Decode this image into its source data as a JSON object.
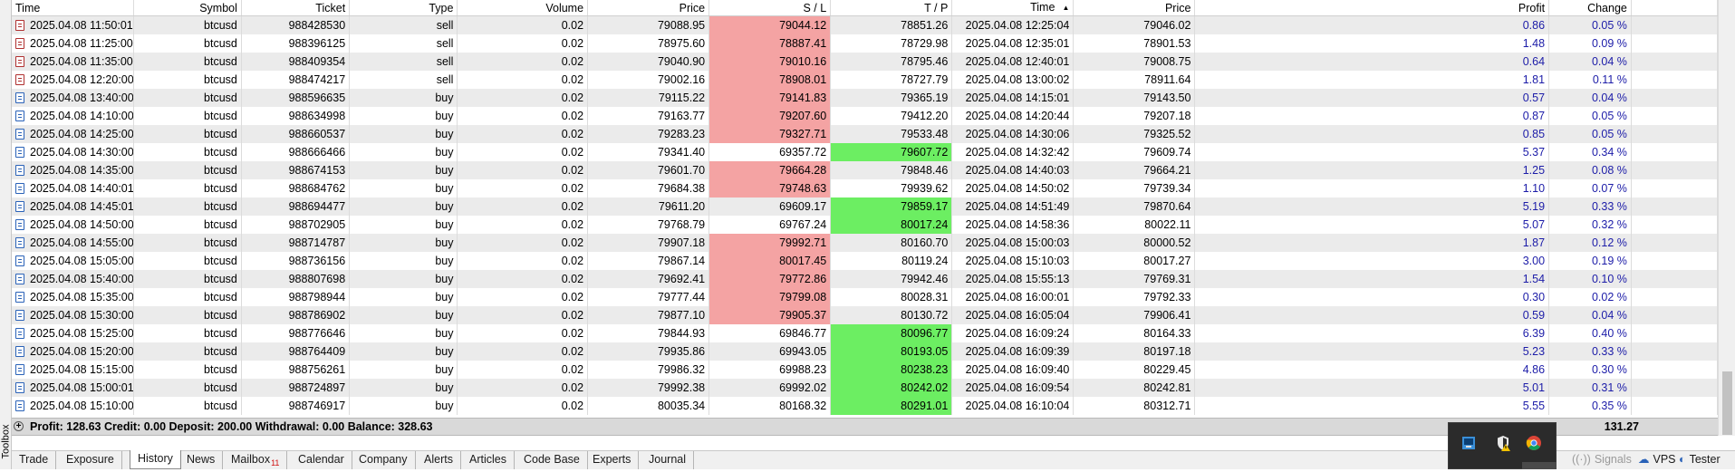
{
  "panel_label": "Toolbox",
  "columns": {
    "time": "Time",
    "symbol": "Symbol",
    "ticket": "Ticket",
    "type": "Type",
    "volume": "Volume",
    "price": "Price",
    "sl": "S / L",
    "tp": "T / P",
    "close_time": "Time",
    "close_price": "Price",
    "profit": "Profit",
    "change": "Change"
  },
  "rows": [
    {
      "time": "2025.04.08 11:50:01",
      "symbol": "btcusd",
      "ticket": "988428530",
      "type": "sell",
      "volume": "0.02",
      "price": "79088.95",
      "sl": "79044.12",
      "tp": "78851.26",
      "close_time": "2025.04.08 12:25:04",
      "close_price": "79046.02",
      "profit": "0.86",
      "change": "0.05 %",
      "hit": "sl"
    },
    {
      "time": "2025.04.08 11:25:00",
      "symbol": "btcusd",
      "ticket": "988396125",
      "type": "sell",
      "volume": "0.02",
      "price": "78975.60",
      "sl": "78887.41",
      "tp": "78729.98",
      "close_time": "2025.04.08 12:35:01",
      "close_price": "78901.53",
      "profit": "1.48",
      "change": "0.09 %",
      "hit": "sl"
    },
    {
      "time": "2025.04.08 11:35:00",
      "symbol": "btcusd",
      "ticket": "988409354",
      "type": "sell",
      "volume": "0.02",
      "price": "79040.90",
      "sl": "79010.16",
      "tp": "78795.46",
      "close_time": "2025.04.08 12:40:01",
      "close_price": "79008.75",
      "profit": "0.64",
      "change": "0.04 %",
      "hit": "sl"
    },
    {
      "time": "2025.04.08 12:20:00",
      "symbol": "btcusd",
      "ticket": "988474217",
      "type": "sell",
      "volume": "0.02",
      "price": "79002.16",
      "sl": "78908.01",
      "tp": "78727.79",
      "close_time": "2025.04.08 13:00:02",
      "close_price": "78911.64",
      "profit": "1.81",
      "change": "0.11 %",
      "hit": "sl"
    },
    {
      "time": "2025.04.08 13:40:00",
      "symbol": "btcusd",
      "ticket": "988596635",
      "type": "buy",
      "volume": "0.02",
      "price": "79115.22",
      "sl": "79141.83",
      "tp": "79365.19",
      "close_time": "2025.04.08 14:15:01",
      "close_price": "79143.50",
      "profit": "0.57",
      "change": "0.04 %",
      "hit": "sl"
    },
    {
      "time": "2025.04.08 14:10:00",
      "symbol": "btcusd",
      "ticket": "988634998",
      "type": "buy",
      "volume": "0.02",
      "price": "79163.77",
      "sl": "79207.60",
      "tp": "79412.20",
      "close_time": "2025.04.08 14:20:44",
      "close_price": "79207.18",
      "profit": "0.87",
      "change": "0.05 %",
      "hit": "sl"
    },
    {
      "time": "2025.04.08 14:25:00",
      "symbol": "btcusd",
      "ticket": "988660537",
      "type": "buy",
      "volume": "0.02",
      "price": "79283.23",
      "sl": "79327.71",
      "tp": "79533.48",
      "close_time": "2025.04.08 14:30:06",
      "close_price": "79325.52",
      "profit": "0.85",
      "change": "0.05 %",
      "hit": "sl"
    },
    {
      "time": "2025.04.08 14:30:00",
      "symbol": "btcusd",
      "ticket": "988666466",
      "type": "buy",
      "volume": "0.02",
      "price": "79341.40",
      "sl": "69357.72",
      "tp": "79607.72",
      "close_time": "2025.04.08 14:32:42",
      "close_price": "79609.74",
      "profit": "5.37",
      "change": "0.34 %",
      "hit": "tp"
    },
    {
      "time": "2025.04.08 14:35:00",
      "symbol": "btcusd",
      "ticket": "988674153",
      "type": "buy",
      "volume": "0.02",
      "price": "79601.70",
      "sl": "79664.28",
      "tp": "79848.46",
      "close_time": "2025.04.08 14:40:03",
      "close_price": "79664.21",
      "profit": "1.25",
      "change": "0.08 %",
      "hit": "sl"
    },
    {
      "time": "2025.04.08 14:40:01",
      "symbol": "btcusd",
      "ticket": "988684762",
      "type": "buy",
      "volume": "0.02",
      "price": "79684.38",
      "sl": "79748.63",
      "tp": "79939.62",
      "close_time": "2025.04.08 14:50:02",
      "close_price": "79739.34",
      "profit": "1.10",
      "change": "0.07 %",
      "hit": "sl"
    },
    {
      "time": "2025.04.08 14:45:01",
      "symbol": "btcusd",
      "ticket": "988694477",
      "type": "buy",
      "volume": "0.02",
      "price": "79611.20",
      "sl": "69609.17",
      "tp": "79859.17",
      "close_time": "2025.04.08 14:51:49",
      "close_price": "79870.64",
      "profit": "5.19",
      "change": "0.33 %",
      "hit": "tp"
    },
    {
      "time": "2025.04.08 14:50:00",
      "symbol": "btcusd",
      "ticket": "988702905",
      "type": "buy",
      "volume": "0.02",
      "price": "79768.79",
      "sl": "69767.24",
      "tp": "80017.24",
      "close_time": "2025.04.08 14:58:36",
      "close_price": "80022.11",
      "profit": "5.07",
      "change": "0.32 %",
      "hit": "tp"
    },
    {
      "time": "2025.04.08 14:55:00",
      "symbol": "btcusd",
      "ticket": "988714787",
      "type": "buy",
      "volume": "0.02",
      "price": "79907.18",
      "sl": "79992.71",
      "tp": "80160.70",
      "close_time": "2025.04.08 15:00:03",
      "close_price": "80000.52",
      "profit": "1.87",
      "change": "0.12 %",
      "hit": "sl"
    },
    {
      "time": "2025.04.08 15:05:00",
      "symbol": "btcusd",
      "ticket": "988736156",
      "type": "buy",
      "volume": "0.02",
      "price": "79867.14",
      "sl": "80017.45",
      "tp": "80119.24",
      "close_time": "2025.04.08 15:10:03",
      "close_price": "80017.27",
      "profit": "3.00",
      "change": "0.19 %",
      "hit": "sl"
    },
    {
      "time": "2025.04.08 15:40:00",
      "symbol": "btcusd",
      "ticket": "988807698",
      "type": "buy",
      "volume": "0.02",
      "price": "79692.41",
      "sl": "79772.86",
      "tp": "79942.46",
      "close_time": "2025.04.08 15:55:13",
      "close_price": "79769.31",
      "profit": "1.54",
      "change": "0.10 %",
      "hit": "sl"
    },
    {
      "time": "2025.04.08 15:35:00",
      "symbol": "btcusd",
      "ticket": "988798944",
      "type": "buy",
      "volume": "0.02",
      "price": "79777.44",
      "sl": "79799.08",
      "tp": "80028.31",
      "close_time": "2025.04.08 16:00:01",
      "close_price": "79792.33",
      "profit": "0.30",
      "change": "0.02 %",
      "hit": "sl"
    },
    {
      "time": "2025.04.08 15:30:00",
      "symbol": "btcusd",
      "ticket": "988786902",
      "type": "buy",
      "volume": "0.02",
      "price": "79877.10",
      "sl": "79905.37",
      "tp": "80130.72",
      "close_time": "2025.04.08 16:05:04",
      "close_price": "79906.41",
      "profit": "0.59",
      "change": "0.04 %",
      "hit": "sl"
    },
    {
      "time": "2025.04.08 15:25:00",
      "symbol": "btcusd",
      "ticket": "988776646",
      "type": "buy",
      "volume": "0.02",
      "price": "79844.93",
      "sl": "69846.77",
      "tp": "80096.77",
      "close_time": "2025.04.08 16:09:24",
      "close_price": "80164.33",
      "profit": "6.39",
      "change": "0.40 %",
      "hit": "tp"
    },
    {
      "time": "2025.04.08 15:20:00",
      "symbol": "btcusd",
      "ticket": "988764409",
      "type": "buy",
      "volume": "0.02",
      "price": "79935.86",
      "sl": "69943.05",
      "tp": "80193.05",
      "close_time": "2025.04.08 16:09:39",
      "close_price": "80197.18",
      "profit": "5.23",
      "change": "0.33 %",
      "hit": "tp"
    },
    {
      "time": "2025.04.08 15:15:00",
      "symbol": "btcusd",
      "ticket": "988756261",
      "type": "buy",
      "volume": "0.02",
      "price": "79986.32",
      "sl": "69988.23",
      "tp": "80238.23",
      "close_time": "2025.04.08 16:09:40",
      "close_price": "80229.45",
      "profit": "4.86",
      "change": "0.30 %",
      "hit": "tp"
    },
    {
      "time": "2025.04.08 15:00:01",
      "symbol": "btcusd",
      "ticket": "988724897",
      "type": "buy",
      "volume": "0.02",
      "price": "79992.38",
      "sl": "69992.02",
      "tp": "80242.02",
      "close_time": "2025.04.08 16:09:54",
      "close_price": "80242.81",
      "profit": "5.01",
      "change": "0.31 %",
      "hit": "tp"
    },
    {
      "time": "2025.04.08 15:10:00",
      "symbol": "btcusd",
      "ticket": "988746917",
      "type": "buy",
      "volume": "0.02",
      "price": "80035.34",
      "sl": "80168.32",
      "tp": "80291.01",
      "close_time": "2025.04.08 16:10:04",
      "close_price": "80312.71",
      "profit": "5.55",
      "change": "0.35 %",
      "hit": "tp"
    }
  ],
  "summary": {
    "text": "Profit: 128.63  Credit: 0.00  Deposit: 200.00  Withdrawal: 0.00  Balance: 328.63",
    "total_profit": "131.27"
  },
  "tabs": [
    {
      "id": "trade",
      "label": "Trade"
    },
    {
      "id": "exposure",
      "label": "Exposure"
    },
    {
      "id": "history",
      "label": "History",
      "active": true
    },
    {
      "id": "news",
      "label": "News"
    },
    {
      "id": "mailbox",
      "label": "Mailbox",
      "badge": "11"
    },
    {
      "id": "calendar",
      "label": "Calendar"
    },
    {
      "id": "company",
      "label": "Company"
    },
    {
      "id": "alerts",
      "label": "Alerts"
    },
    {
      "id": "articles",
      "label": "Articles"
    },
    {
      "id": "codebase",
      "label": "Code Base"
    },
    {
      "id": "experts",
      "label": "Experts"
    },
    {
      "id": "journal",
      "label": "Journal"
    }
  ],
  "right_tabs": {
    "signals": "Signals",
    "vps": "VPS",
    "tester": "Tester"
  },
  "colors": {
    "sl_hit": "#f4a3a3",
    "tp_hit": "#6cee62",
    "profit_text": "#1c1ca8",
    "row_alt": "#ebebeb",
    "summary_bg": "#d9d9d9"
  },
  "tray_icons": [
    "network-icon",
    "security-shield-icon",
    "chrome-icon"
  ]
}
